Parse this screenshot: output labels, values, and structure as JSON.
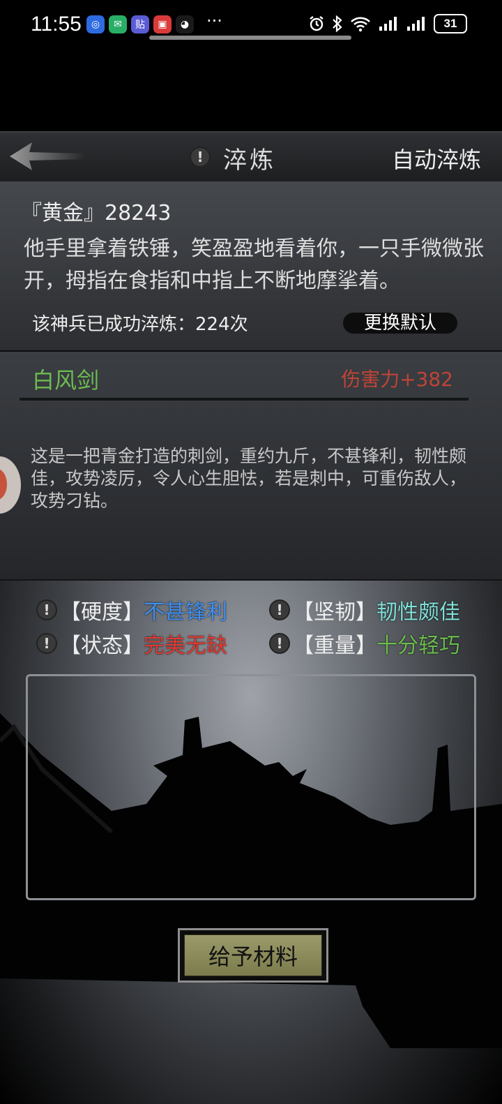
{
  "status_bar": {
    "time": "11:55",
    "apps": [
      {
        "icon": "browser-icon",
        "color": "#2f6be0",
        "glyph": "◎"
      },
      {
        "icon": "wechat-icon",
        "color": "#2aae67",
        "glyph": "✉"
      },
      {
        "icon": "tieba-icon",
        "color": "#5b5bd6",
        "glyph": "贴"
      },
      {
        "icon": "news-icon",
        "color": "#d93a3a",
        "glyph": "▣"
      },
      {
        "icon": "qq-icon",
        "color": "#1a1a1a",
        "glyph": "◕"
      }
    ],
    "more": "···",
    "battery": "31"
  },
  "header": {
    "warn_glyph": "!",
    "title": "淬炼",
    "auto_button": "自动淬炼"
  },
  "info": {
    "master": "『黄金』28243",
    "description": "他手里拿着铁锤，笑盈盈地看着你，一只手微微张开，拇指在食指和中指上不断地摩挲着。",
    "refine_count": "该神兵已成功淬炼：224次",
    "change_default_button": "更换默认"
  },
  "weapon": {
    "name": "白风剑",
    "damage": "伤害力+382",
    "description": "这是一把青金打造的刺剑，重约九斤，不甚锋利，韧性颇佳，攻势凌厉，令人心生胆怯，若是刺中，可重伤敌人，攻势刁钻。"
  },
  "attributes": [
    {
      "label": "【硬度】",
      "value": "不甚锋利",
      "color": "#3f8ff0"
    },
    {
      "label": "【坚韧】",
      "value": "韧性颇佳",
      "color": "#7fe0d8"
    },
    {
      "label": "【状态】",
      "value": "完美无缺",
      "color": "#e23b32"
    },
    {
      "label": "【重量】",
      "value": "十分轻巧",
      "color": "#6cbe4e"
    }
  ],
  "give_button": "给予材料"
}
